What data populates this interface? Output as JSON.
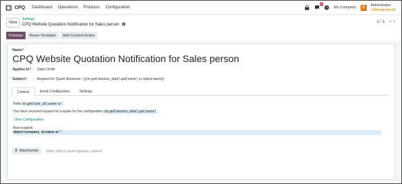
{
  "navbar": {
    "app_name": "CPQ",
    "menu": [
      "Dashboard",
      "Operations",
      "Products",
      "Configuration"
    ],
    "notification_count": "2",
    "company": "My Company",
    "avatar_letter": "A",
    "user_name": "Administrator",
    "db_name": "v18ee-cpq-core-Q8"
  },
  "control_panel": {
    "new_label": "New",
    "breadcrumb_parent": "Settings",
    "breadcrumb_current": "CPQ Website Quotation Notification for Sales person",
    "pager": "1 / 1"
  },
  "actions": [
    "Preview",
    "Reset Template",
    "Add Context Action"
  ],
  "form": {
    "name_label": "Name",
    "name_value": "CPQ Website Quotation Notification for Sales person",
    "applies_to_label": "Applies to",
    "applies_to_value": "Sales Order",
    "subject_label": "Subject",
    "subject_value": "Request for Quote Received - {{ctx.get('session_data').get('name') or object.name}}",
    "tabs": [
      "Content",
      "Email Configuration",
      "Settings"
    ],
    "content": {
      "hello_prefix": "Hello ",
      "hello_expr": "ctx.get('user_id').name or ''",
      "line2_prefix": "You have received request for a quote for the configuration ",
      "line2_expr": "ctx.get('session_data').get('name')",
      "line2_suffix": ".",
      "view_link": "View Configuration",
      "regards": "Best regards,",
      "company_expr": "object.company_id.name or ''"
    },
    "attachments_label": "Attachments",
    "attachments_hint": "Write /field to insert dynamic content"
  },
  "colors": {
    "primary": "#714b67",
    "link": "#017e84",
    "highlight": "#d9ebf7",
    "avatar": "#e07b24"
  }
}
